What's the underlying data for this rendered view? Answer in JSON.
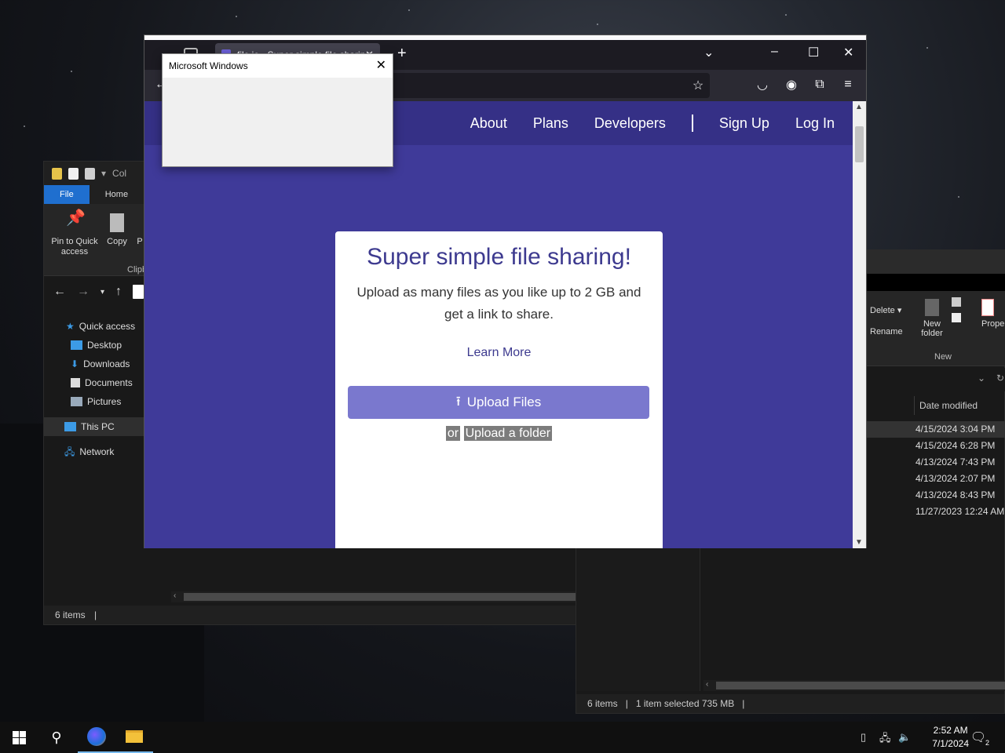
{
  "explorer_left": {
    "ribbon_tabs": [
      "File",
      "Home"
    ],
    "qat_text": "Col",
    "buttons": {
      "pin": "Pin to Quick access",
      "copy": "Copy",
      "extra": "P"
    },
    "group_label": "Clipb",
    "nav": [
      "Quick access",
      "Desktop",
      "Downloads",
      "Documents",
      "Pictures",
      "This PC",
      "Network"
    ],
    "status": "6 items"
  },
  "explorer_right": {
    "ribbon": {
      "delete": "Delete",
      "rename": "Rename",
      "new_folder": "New folder",
      "new_group": "New",
      "properties": "Prope"
    },
    "column_header": "Date modified",
    "dates": [
      "4/15/2024 3:04 PM",
      "4/15/2024 6:28 PM",
      "4/13/2024 7:43 PM",
      "4/13/2024 2:07 PM",
      "4/13/2024 8:43 PM",
      "11/27/2023 12:24 AM"
    ],
    "status": {
      "count": "6 items",
      "selection": "1 item selected  735 MB"
    }
  },
  "browser": {
    "tab_title": "file.io - Super simple file sharing",
    "site_nav": [
      "About",
      "Plans",
      "Developers",
      "Sign Up",
      "Log In"
    ],
    "card": {
      "title": "Super simple file sharing!",
      "subtitle": "Upload as many files as you like up to 2 GB and get a link to share.",
      "learn_more": "Learn More",
      "upload_button": "Upload Files",
      "or": "or",
      "upload_folder": "Upload a folder"
    }
  },
  "dialog": {
    "title": "Microsoft Windows"
  },
  "taskbar": {
    "time": "2:52 AM",
    "date": "7/1/2024",
    "notifications": "2"
  },
  "colors": {
    "site_bg": "#3f3a99",
    "site_nav": "#353086",
    "upload_btn": "#7a78ce",
    "accent_text": "#3d3a8f"
  }
}
